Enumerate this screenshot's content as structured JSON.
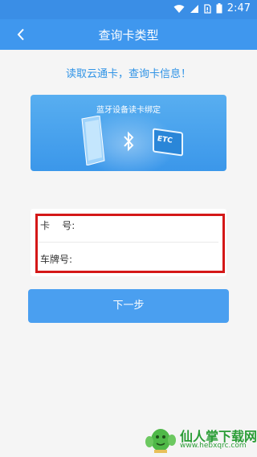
{
  "status_bar": {
    "time": "2:47",
    "icons": [
      "wifi-icon",
      "signal-icon",
      "sim-icon",
      "battery-icon"
    ]
  },
  "app_bar": {
    "title": "查询卡类型",
    "back_icon": "chevron-left-icon"
  },
  "hint": "读取云通卡，查询卡信息！",
  "banner": {
    "title": "蓝牙设备读卡绑定",
    "card_text": "ETC",
    "icons": [
      "phone-icon",
      "bluetooth-icon",
      "etc-card-icon"
    ]
  },
  "form": {
    "card_number_label": "卡    号:",
    "card_number_value": "",
    "plate_label": "车牌号:",
    "plate_value": ""
  },
  "next_button": "下一步",
  "watermark": {
    "text": "仙人掌下载网",
    "url": "www.hebxqrc.com"
  },
  "colors": {
    "primary": "#3f97ee",
    "accent_text": "#2f93e6",
    "highlight": "#d41818",
    "watermark": "#2a9d36"
  }
}
